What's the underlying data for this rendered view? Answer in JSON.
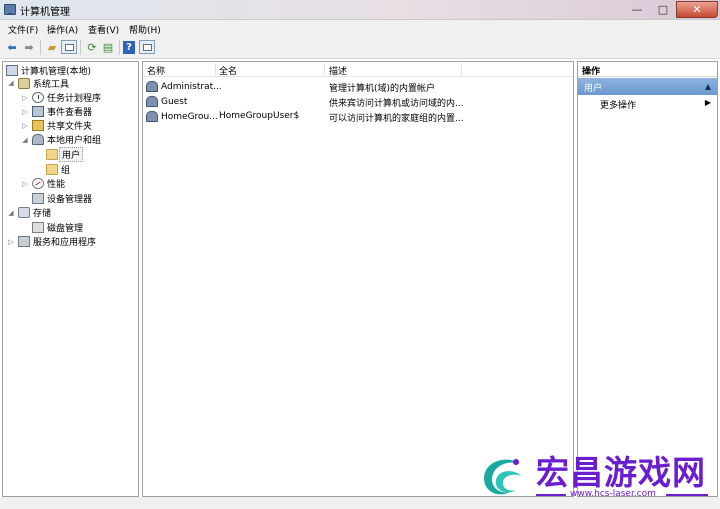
{
  "window": {
    "title": "计算机管理"
  },
  "titlebar_buttons": {
    "minimize": "—",
    "maximize": "□",
    "close": "✕"
  },
  "menu": [
    "文件(F)",
    "操作(A)",
    "查看(V)",
    "帮助(H)"
  ],
  "toolbar_icons": [
    "back-arrow-icon",
    "forward-arrow-icon",
    "up-folder-icon",
    "show-hide-tree-icon",
    "refresh-icon",
    "export-list-icon",
    "help-icon",
    "show-hide-action-pane-icon"
  ],
  "tree": {
    "root": "计算机管理(本地)",
    "system_tools": "系统工具",
    "task_scheduler": "任务计划程序",
    "event_viewer": "事件查看器",
    "shared_folders": "共享文件夹",
    "local_users_groups": "本地用户和组",
    "users": "用户",
    "groups": "组",
    "performance": "性能",
    "device_manager": "设备管理器",
    "storage": "存储",
    "disk_management": "磁盘管理",
    "services_apps": "服务和应用程序"
  },
  "list": {
    "columns": [
      "名称",
      "全名",
      "描述"
    ],
    "rows": [
      {
        "name": "Administrat...",
        "fullname": "",
        "description": "管理计算机(域)的内置帐户"
      },
      {
        "name": "Guest",
        "fullname": "",
        "description": "供来宾访问计算机或访问域的内..."
      },
      {
        "name": "HomeGrou...",
        "fullname": "HomeGroupUser$",
        "description": "可以访问计算机的家庭组的内置..."
      }
    ]
  },
  "actions": {
    "header": "操作",
    "group": "用户",
    "more": "更多操作"
  },
  "watermark": {
    "title": "宏昌游戏网",
    "url": "www.hcs-laser.com"
  },
  "colors": {
    "accent": "#6b98cf",
    "watermark": "#6a1ed0"
  }
}
